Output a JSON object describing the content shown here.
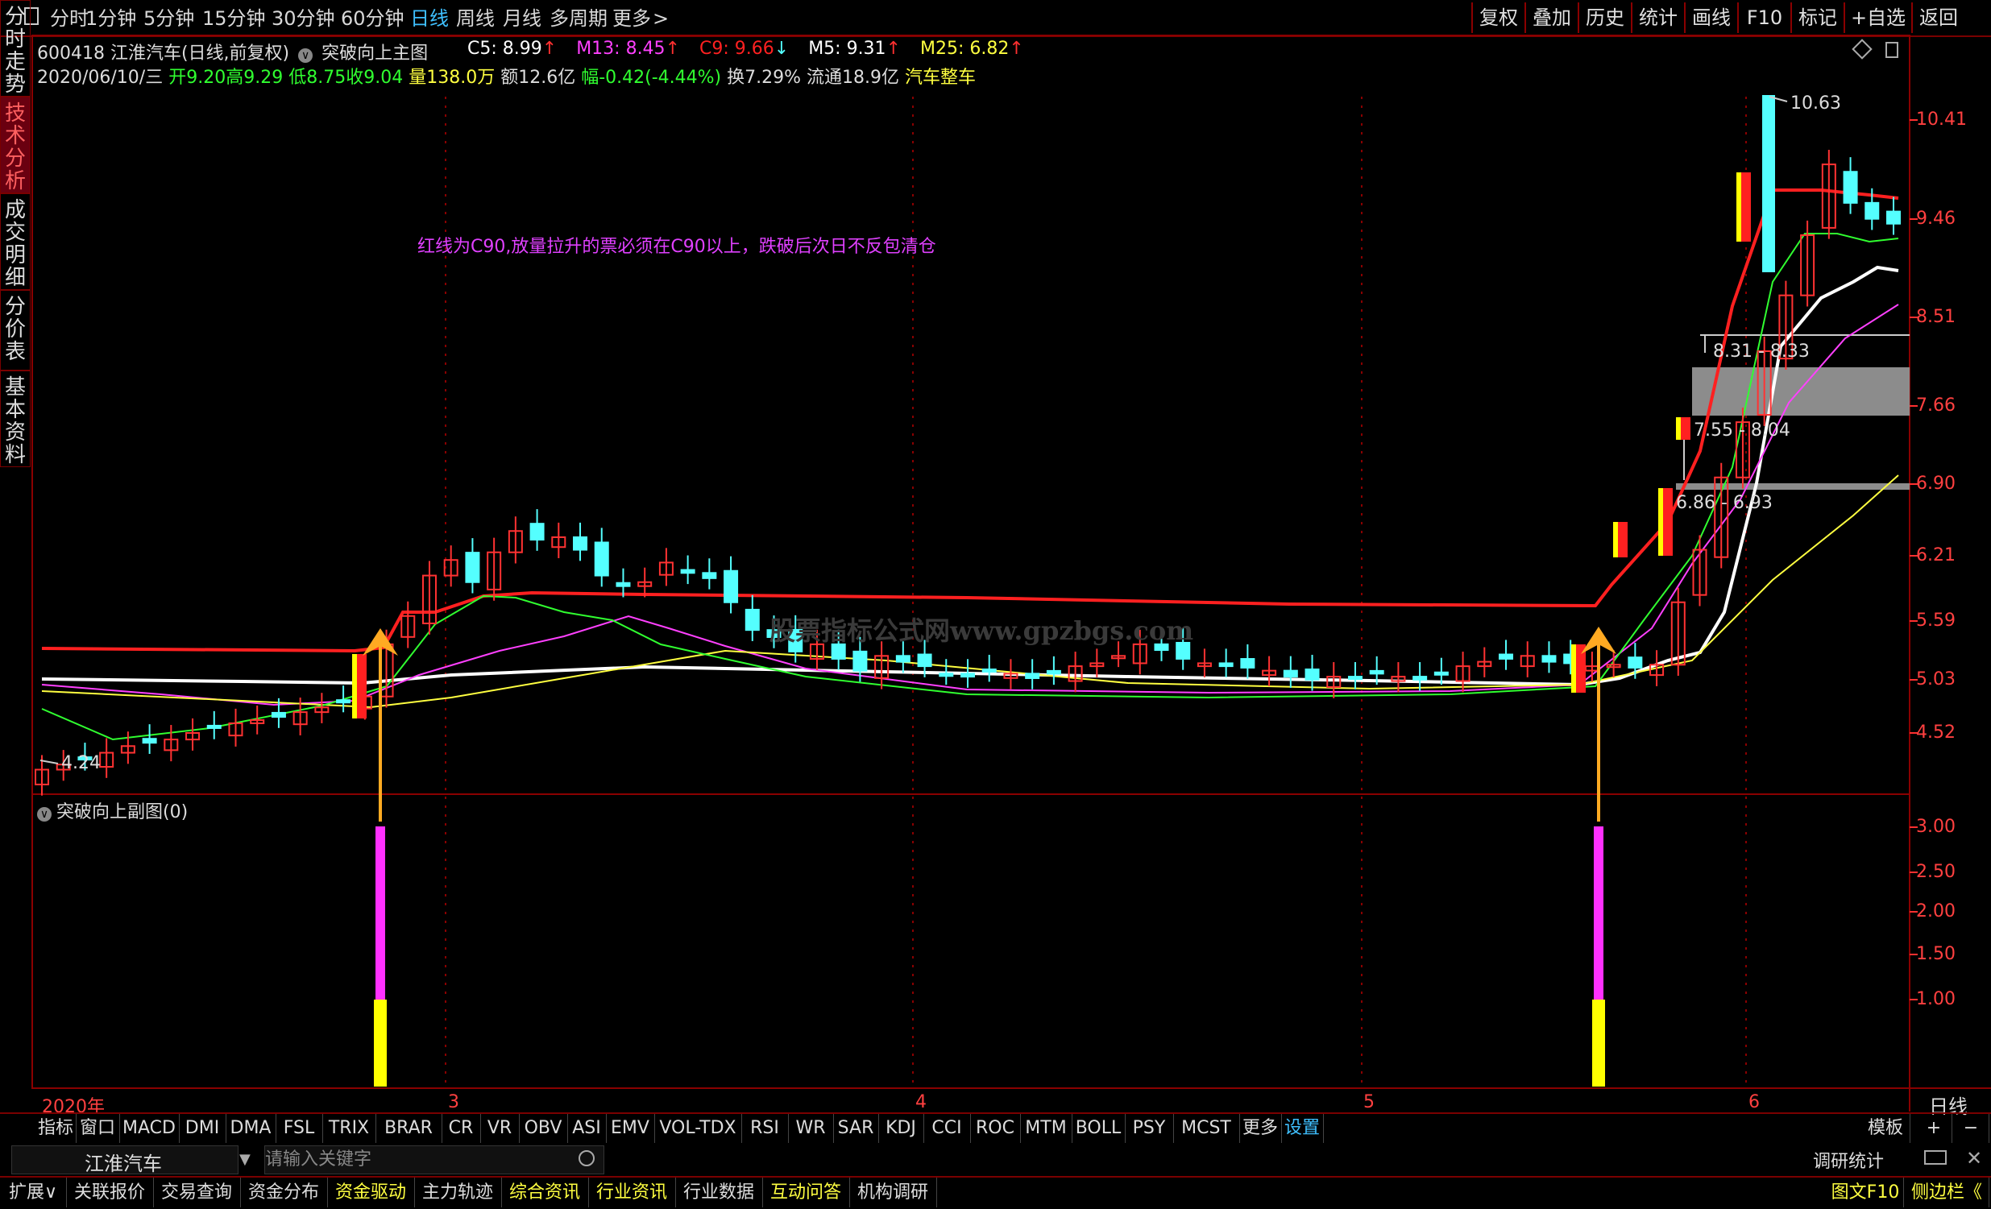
{
  "topbar": {
    "left_tabs": [
      "分时",
      "1分钟",
      "5分钟",
      "15分钟",
      "30分钟",
      "60分钟",
      "日线",
      "周线",
      "月线",
      "多周期",
      "更多"
    ],
    "active_tab": "日线",
    "right_tabs": [
      "复权",
      "叠加",
      "历史",
      "统计",
      "画线",
      "F10",
      "标记",
      "+自选",
      "返回"
    ]
  },
  "sidebar": {
    "tabs": [
      "分时走势",
      "技术分析",
      "成交明细",
      "分价表",
      "基本资料"
    ],
    "active": "技术分析"
  },
  "header": {
    "code_name": "600418 江淮汽车(日线,前复权)",
    "indicator_name": "突破向上主图",
    "ma": [
      {
        "label": "C5: 8.99",
        "dir": "↑",
        "color": "#ffffff"
      },
      {
        "label": "M13: 8.45",
        "dir": "↑",
        "color": "#ff40ff"
      },
      {
        "label": "C9: 9.66",
        "dir": "↓",
        "color": "#ff2020"
      },
      {
        "label": "M5: 9.31",
        "dir": "↑",
        "color": "#ffffff"
      },
      {
        "label": "M25: 6.82",
        "dir": "↑",
        "color": "#ffff40"
      }
    ],
    "line2": {
      "date": "2020/06/10/三",
      "open": "开9.20",
      "high": "高9.29",
      "low": "低8.75",
      "close": "收9.04",
      "vol": "量138.0万",
      "amount": "额12.6亿",
      "change": "幅-0.42(-4.44%)",
      "turnover": "换7.29%",
      "float": "流通18.9亿",
      "industry": "汽车整车"
    }
  },
  "annotation": "红线为C90,放量拉升的票必须在C90以上，跌破后次日不反包清仓",
  "watermark": "股票指标公式网www.gpzbgs.com",
  "sub_chart_title": "突破向上副图(0)",
  "price_axis": [
    "10.41",
    "9.46",
    "8.51",
    "7.66",
    "6.90",
    "6.21",
    "5.59",
    "5.03",
    "4.52"
  ],
  "sub_axis": [
    "3.00",
    "2.50",
    "2.00",
    "1.50",
    "1.00"
  ],
  "max_label": "10.63",
  "min_label": "4.24",
  "zones": [
    {
      "label": "8.31 - 8.33",
      "low": 8.31,
      "high": 8.33
    },
    {
      "label": "7.55 - 8.04",
      "low": 7.55,
      "high": 8.04
    },
    {
      "label": "6.86 - 6.93",
      "low": 6.86,
      "high": 6.93
    }
  ],
  "date_axis": [
    "2020年",
    "3",
    "4",
    "5",
    "6"
  ],
  "period_label": "日线",
  "bottom_tabs": [
    "指标",
    "窗口",
    "MACD",
    "DMI",
    "DMA",
    "FSL",
    "TRIX",
    "BRAR",
    "CR",
    "VR",
    "OBV",
    "ASI",
    "EMV",
    "VOL-TDX",
    "RSI",
    "WR",
    "SAR",
    "KDJ",
    "CCI",
    "ROC",
    "MTM",
    "BOLL",
    "PSY",
    "MCST",
    "更多",
    "设置"
  ],
  "bottom_right": [
    "模板",
    "+",
    "−"
  ],
  "search": {
    "stock": "江淮汽车",
    "placeholder": "请输入关键字",
    "right": "调研统计"
  },
  "status_tabs": [
    {
      "label": "扩展∨",
      "color": "#dddddd"
    },
    {
      "label": "关联报价",
      "color": "#dddddd"
    },
    {
      "label": "交易查询",
      "color": "#dddddd"
    },
    {
      "label": "资金分布",
      "color": "#dddddd"
    },
    {
      "label": "资金驱动",
      "color": "#ffff40"
    },
    {
      "label": "主力轨迹",
      "color": "#dddddd"
    },
    {
      "label": "综合资讯",
      "color": "#ffff40"
    },
    {
      "label": "行业资讯",
      "color": "#ffff40"
    },
    {
      "label": "行业数据",
      "color": "#dddddd"
    },
    {
      "label": "互动问答",
      "color": "#ffff40"
    },
    {
      "label": "机构调研",
      "color": "#dddddd"
    }
  ],
  "status_right": [
    "图文F10",
    "侧边栏《"
  ],
  "colors": {
    "up": "#ff3232",
    "down": "#54ffff",
    "c90": "#ff2020",
    "m5": "#ffffff",
    "m13": "#ff40ff",
    "m25": "#ffff40",
    "mid": "#30ff30"
  }
}
